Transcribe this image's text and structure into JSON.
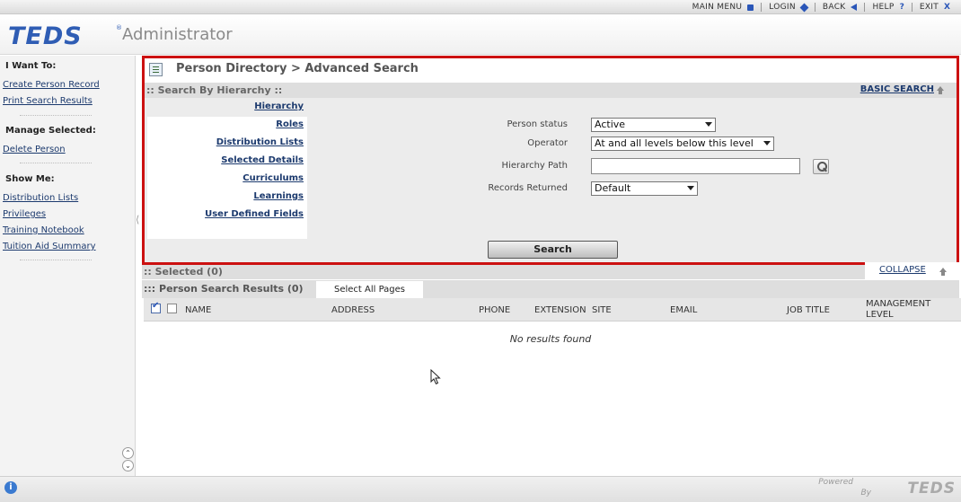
{
  "topnav": {
    "main_menu": "MAIN MENU",
    "login": "LOGIN",
    "back": "BACK",
    "help": "HELP",
    "help_icon": "?",
    "exit": "EXIT",
    "exit_icon": "X"
  },
  "header": {
    "logo_text": "TEDS",
    "logo_reg": "®",
    "app_name": "Administrator"
  },
  "sidebar": {
    "i_want_to_title": "I Want To:",
    "i_want_to": [
      "Create Person Record",
      "Print Search Results"
    ],
    "manage_selected_title": "Manage Selected:",
    "manage_selected": [
      "Delete Person"
    ],
    "show_me_title": "Show Me:",
    "show_me": [
      "Distribution Lists",
      "Privileges",
      "Training Notebook",
      "Tuition Aid Summary"
    ]
  },
  "page": {
    "title": "Person Directory > Advanced Search"
  },
  "search_by_hierarchy": {
    "bar_label": ":: Search By Hierarchy ::",
    "basic_search_link": "BASIC SEARCH",
    "criteria_links": [
      "Hierarchy",
      "Roles",
      "Distribution Lists",
      "Selected Details",
      "Curriculums",
      "Learnings",
      "User Defined Fields"
    ]
  },
  "form": {
    "person_status_label": "Person status",
    "person_status_value": "Active",
    "operator_label": "Operator",
    "operator_value": "At and all levels below this level",
    "hierarchy_path_label": "Hierarchy Path",
    "hierarchy_path_value": "",
    "records_returned_label": "Records Returned",
    "records_returned_value": "Default",
    "search_button": "Search"
  },
  "selected": {
    "label": ":: Selected (0)",
    "collapse_link": "COLLAPSE"
  },
  "results": {
    "label": "::: Person Search Results (0)",
    "select_all_pages": "Select All Pages",
    "columns": [
      "NAME",
      "ADDRESS",
      "PHONE",
      "EXTENSION",
      "SITE",
      "EMAIL",
      "JOB TITLE",
      "MANAGEMENT LEVEL"
    ],
    "management_level_line1": "MANAGEMENT",
    "management_level_line2": "LEVEL",
    "empty_message": "No results found"
  },
  "footer": {
    "info_icon": "i",
    "powered": "Powered",
    "by": "By",
    "logo_text": "TEDS"
  },
  "colors": {
    "accent_red": "#cc1111",
    "brand_blue": "#2f5db4",
    "link_blue": "#1c3a6e"
  },
  "icons": {
    "main_menu": "square-icon",
    "login": "diamond-icon",
    "back": "back-triangle-icon",
    "help": "question-icon",
    "exit": "close-icon",
    "lookup": "magnifier-icon",
    "up": "up-arrow-icon",
    "info": "info-icon"
  }
}
